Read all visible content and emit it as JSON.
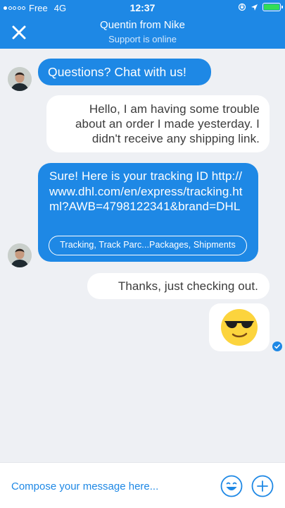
{
  "status_bar": {
    "carrier": "Free",
    "network": "4G",
    "time": "12:37",
    "signal_level": 0.2,
    "battery_level": 1.0
  },
  "header": {
    "title": "Quentin from Nike",
    "subtitle": "Support is online",
    "background": "#1e88e5"
  },
  "messages": [
    {
      "sender": "agent",
      "text": "Questions? Chat with us!"
    },
    {
      "sender": "user",
      "text": "Hello, I am having some trouble about an order I made yesterday. I didn't receive any shipping link."
    },
    {
      "sender": "agent",
      "text": "Sure! Here is your tracking ID http://www.dhl.com/en/express/tracking.html?AWB=4798122341&brand=DHL",
      "tag": "Tracking, Track Parc...Packages, Shipments"
    },
    {
      "sender": "user",
      "text": "Thanks, just checking out."
    },
    {
      "sender": "user",
      "emoji": "smiling-face-with-sunglasses",
      "read": true
    }
  ],
  "composer": {
    "placeholder": "Compose your message here...",
    "value": ""
  },
  "colors": {
    "accent": "#1e88e5",
    "background": "#eef0f4",
    "user_bubble": "#ffffff",
    "battery": "#33dd55"
  }
}
